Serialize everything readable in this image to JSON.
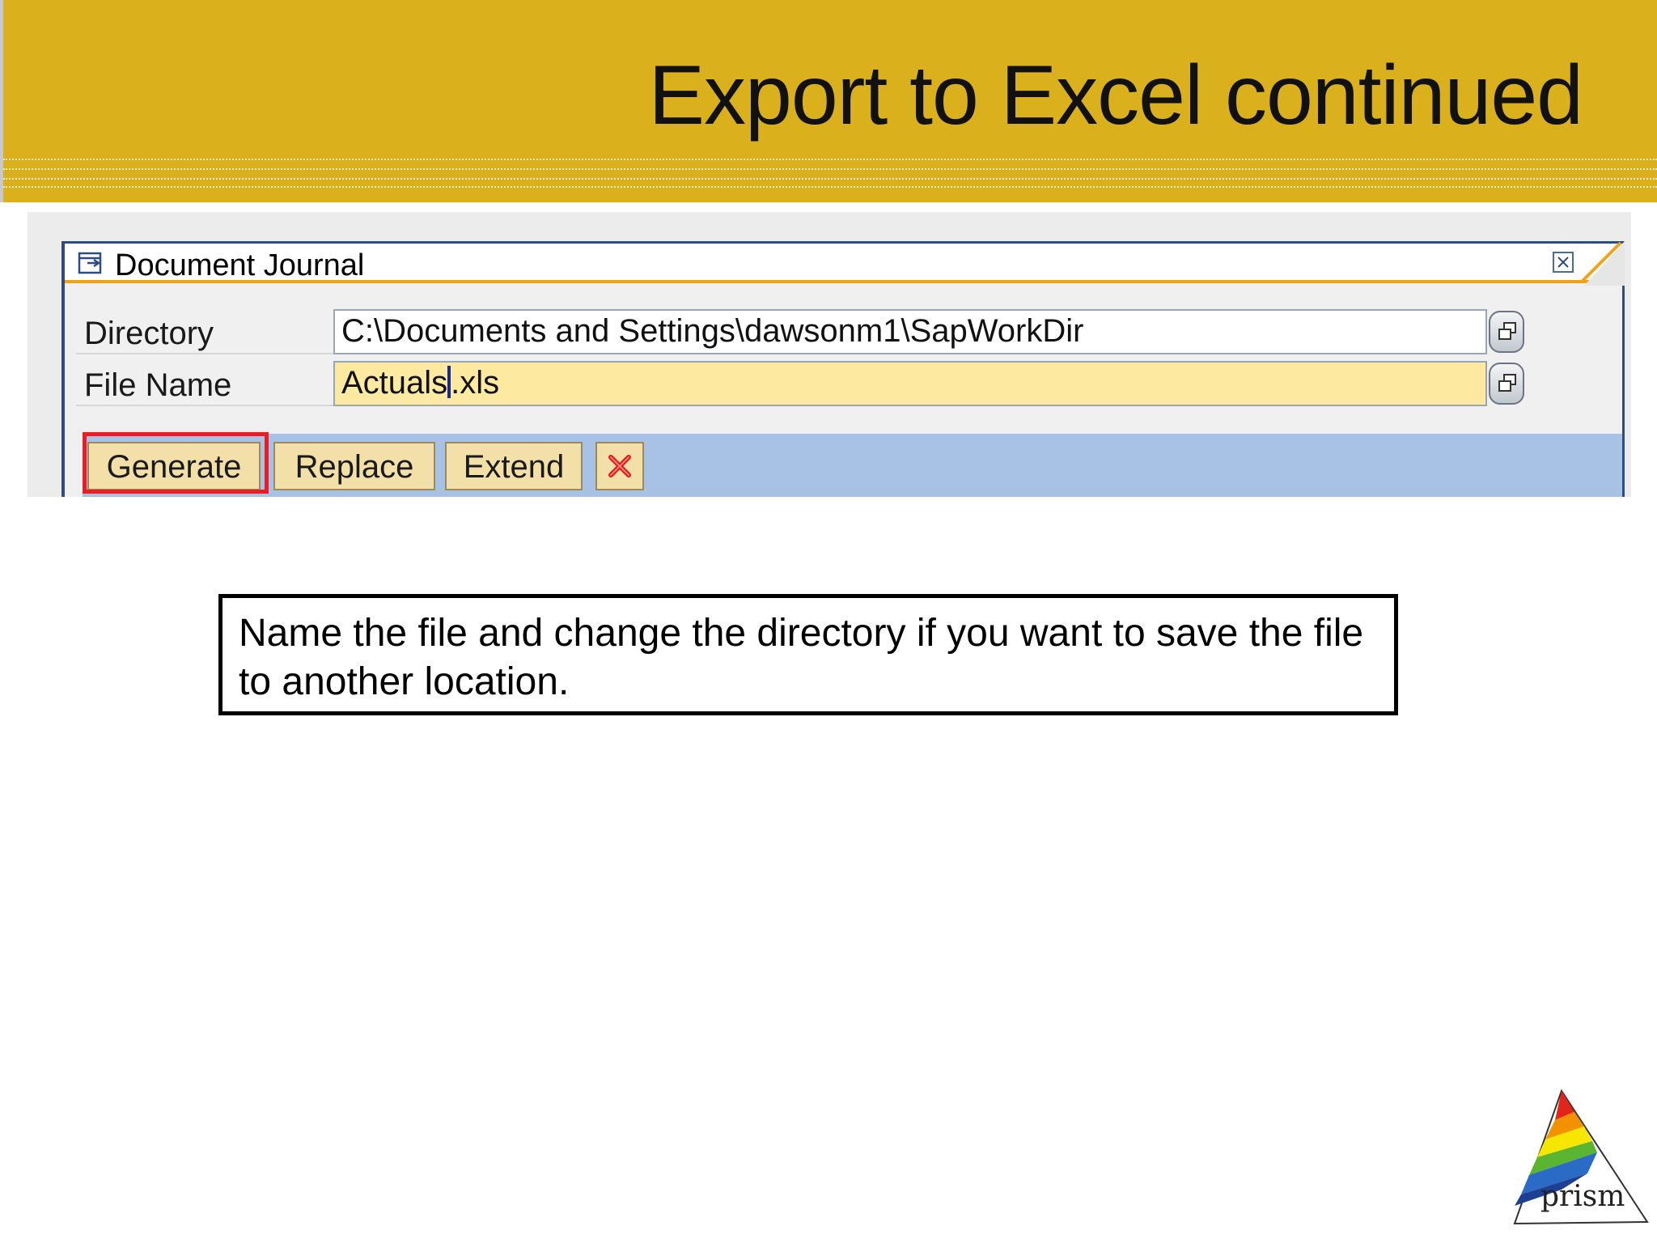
{
  "slide": {
    "title": "Export to Excel continued"
  },
  "dialog": {
    "title": "Document Journal",
    "directory_label": "Directory",
    "directory_value": "C:\\Documents and Settings\\dawsonm1\\SapWorkDir",
    "file_name_label": "File Name",
    "file_name_before_cursor": "Actuals",
    "file_name_after_cursor": ".xls",
    "buttons": {
      "generate": "Generate",
      "replace": "Replace",
      "extend": "Extend"
    }
  },
  "note": {
    "text": "Name the file and change the directory if you want to save the file to another location."
  },
  "logo": {
    "text": "prism"
  },
  "colors": {
    "header_gold": "#dab01c",
    "toolbar_blue": "#a7c2e4",
    "button_fill": "#f2e0a8",
    "highlight_red": "#ea1c24",
    "input_yellow": "#fdeaa0",
    "accent_orange": "#f0a21a"
  },
  "icons": {
    "dialog": "window-icon",
    "close": "close-icon",
    "value_help": "value-help-icon",
    "cancel": "cancel-x-icon"
  }
}
